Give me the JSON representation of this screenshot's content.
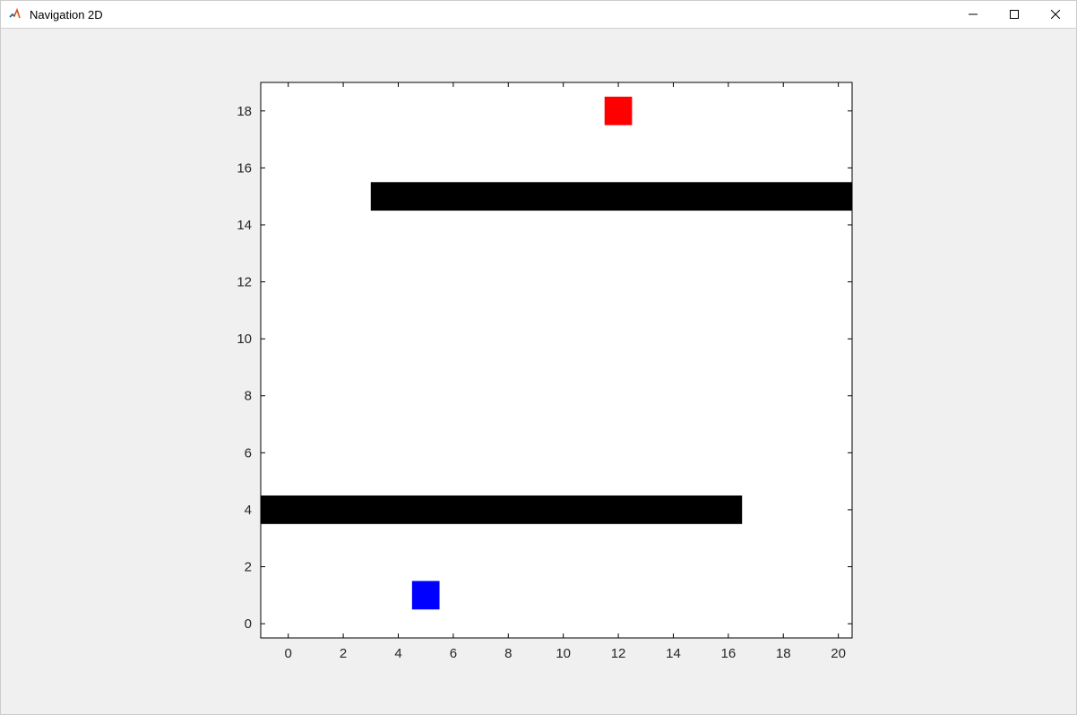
{
  "window": {
    "title": "Navigation 2D"
  },
  "chart_data": {
    "type": "scatter",
    "title": "",
    "xlabel": "",
    "ylabel": "",
    "xlim": [
      -1,
      20.5
    ],
    "ylim": [
      -0.5,
      19
    ],
    "xticks": [
      0,
      2,
      4,
      6,
      8,
      10,
      12,
      14,
      16,
      18,
      20
    ],
    "yticks": [
      0,
      2,
      4,
      6,
      8,
      10,
      12,
      14,
      16,
      18
    ],
    "obstacles": [
      {
        "name": "lower-wall",
        "x0": -1.0,
        "x1": 16.5,
        "y0": 3.5,
        "y1": 4.5,
        "color": "#000000"
      },
      {
        "name": "upper-wall",
        "x0": 3.0,
        "x1": 20.5,
        "y0": 14.5,
        "y1": 15.5,
        "color": "#000000"
      }
    ],
    "markers": [
      {
        "name": "agent",
        "x": 5.0,
        "y": 1.0,
        "size": 1.0,
        "color": "#0000ff"
      },
      {
        "name": "goal",
        "x": 12.0,
        "y": 18.0,
        "size": 1.0,
        "color": "#ff0000"
      }
    ]
  }
}
